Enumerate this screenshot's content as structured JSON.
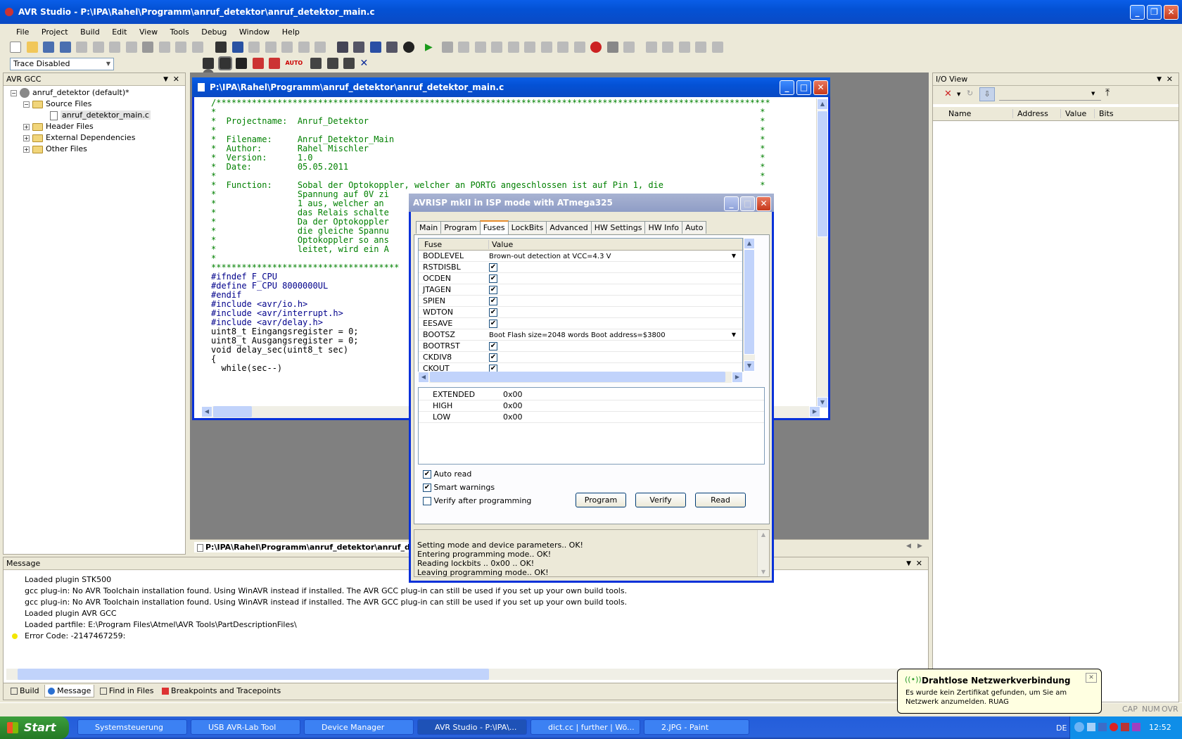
{
  "app": {
    "title": "AVR Studio - P:\\IPA\\Rahel\\Programm\\anruf_detektor\\anruf_detektor_main.c",
    "menu": [
      "File",
      "Project",
      "Build",
      "Edit",
      "View",
      "Tools",
      "Debug",
      "Window",
      "Help"
    ],
    "trace_select": "Trace Disabled"
  },
  "left_panel": {
    "title": "AVR GCC",
    "tree": {
      "root": "anruf_detektor (default)*",
      "source_files": "Source Files",
      "main_file": "anruf_detektor_main.c",
      "header_files": "Header Files",
      "external": "External Dependencies",
      "other": "Other Files"
    }
  },
  "editor": {
    "title": "P:\\IPA\\Rahel\\Programm\\anruf_detektor\\anruf_detektor_main.c",
    "lines": [
      "/*************************************************************************************************************",
      "*                                                                                                           *",
      "*  Projectname:  Anruf_Detektor                                                                             *",
      "*                                                                                                           *",
      "*  Filename:     Anruf_Detektor_Main                                                                        *",
      "*  Author:       Rahel Mischler                                                                             *",
      "*  Version:      1.0                                                                                        *",
      "*  Date:         05.05.2011                                                                                 *",
      "*                                                                                                           *",
      "*  Function:     Sobal der Optokoppler, welcher an PORTG angeschlossen ist auf Pin 1, die                   *",
      "*                Spannung auf 0V zi",
      "*                1 aus, welcher an",
      "*                das Relais schalte",
      "*                Da der Optokoppler",
      "*                die gleiche Spannu",
      "*                Optokoppler so ans",
      "*                leitet, wird ein A",
      "*",
      "*************************************",
      "",
      "#ifndef F_CPU",
      "#define F_CPU 8000000UL",
      "#endif",
      "",
      "#include <avr/io.h>",
      "#include <avr/interrupt.h>",
      "#include <avr/delay.h>",
      "",
      "uint8_t Eingangsregister = 0;",
      "uint8_t Ausgangsregister = 0;",
      "",
      "void delay_sec(uint8_t sec)",
      "{",
      "  while(sec--)"
    ],
    "tab_label": "P:\\IPA\\Rahel\\Programm\\anruf_detektor\\anruf_de"
  },
  "io_view": {
    "title": "I/O View",
    "columns": [
      "Name",
      "Address",
      "Value",
      "Bits"
    ]
  },
  "dialog": {
    "title": "AVRISP mkII in ISP mode with ATmega325",
    "tabs": [
      "Main",
      "Program",
      "Fuses",
      "LockBits",
      "Advanced",
      "HW Settings",
      "HW Info",
      "Auto"
    ],
    "selected_tab": "Fuses",
    "fuse_header": {
      "fuse": "Fuse",
      "value": "Value"
    },
    "fuses": [
      {
        "name": "BODLEVEL",
        "value": "Brown-out detection at VCC=4.3 V",
        "type": "select"
      },
      {
        "name": "RSTDISBL",
        "type": "check",
        "checked": true
      },
      {
        "name": "OCDEN",
        "type": "check",
        "checked": true
      },
      {
        "name": "JTAGEN",
        "type": "check",
        "checked": true
      },
      {
        "name": "SPIEN",
        "type": "check",
        "checked": true
      },
      {
        "name": "WDTON",
        "type": "check",
        "checked": true
      },
      {
        "name": "EESAVE",
        "type": "check",
        "checked": true
      },
      {
        "name": "BOOTSZ",
        "value": "Boot Flash size=2048 words Boot address=$3800",
        "type": "select"
      },
      {
        "name": "BOOTRST",
        "type": "check",
        "checked": true
      },
      {
        "name": "CKDIV8",
        "type": "check",
        "checked": true
      },
      {
        "name": "CKOUT",
        "type": "check",
        "checked": true
      }
    ],
    "registers": [
      {
        "name": "EXTENDED",
        "value": "0x00"
      },
      {
        "name": "HIGH",
        "value": "0x00"
      },
      {
        "name": "LOW",
        "value": "0x00"
      }
    ],
    "auto_read": "Auto read",
    "smart_warnings": "Smart warnings",
    "verify_after": "Verify after programming",
    "btn_program": "Program",
    "btn_verify": "Verify",
    "btn_read": "Read",
    "log": [
      "Setting mode and device parameters.. OK!",
      "Entering programming mode.. OK!",
      "Reading lockbits .. 0x00 .. OK!",
      "Leaving programming mode.. OK!"
    ]
  },
  "message_panel": {
    "title": "Message",
    "lines": [
      "Loaded plugin STK500",
      "gcc plug-in: No AVR Toolchain installation found. Using WinAVR instead if installed. The AVR GCC plug-in can still be used if you set up your own build tools.",
      "gcc plug-in: No AVR Toolchain installation found. Using WinAVR instead if installed. The AVR GCC plug-in can still be used if you set up your own build tools.",
      "Loaded plugin AVR GCC",
      "Loaded partfile: E:\\Program Files\\Atmel\\AVR Tools\\PartDescriptionFiles\\",
      "Error Code: -2147467259:"
    ],
    "tabs": [
      "Build",
      "Message",
      "Find in Files",
      "Breakpoints and Tracepoints"
    ]
  },
  "status": {
    "cap": "CAP",
    "num": "NUM",
    "ovr": "OVR"
  },
  "balloon": {
    "title": "Drahtlose Netzwerkverbindung",
    "text": "Es wurde kein Zertifikat gefunden, um Sie am Netzwerk anzumelden. RUAG"
  },
  "taskbar": {
    "start": "Start",
    "tasks": [
      "Systemsteuerung",
      "USB AVR-Lab Tool",
      "Device Manager",
      "AVR Studio - P:\\IPA\\...",
      "dict.cc | further | Wö...",
      "2.JPG - Paint"
    ],
    "lang": "DE",
    "clock": "12:52"
  }
}
